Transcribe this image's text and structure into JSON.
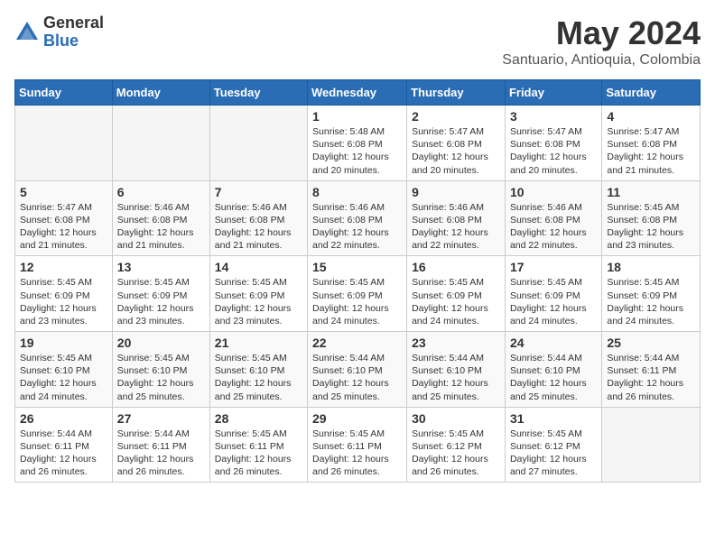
{
  "logo": {
    "general": "General",
    "blue": "Blue"
  },
  "title": "May 2024",
  "location": "Santuario, Antioquia, Colombia",
  "weekdays": [
    "Sunday",
    "Monday",
    "Tuesday",
    "Wednesday",
    "Thursday",
    "Friday",
    "Saturday"
  ],
  "weeks": [
    [
      {
        "day": "",
        "info": ""
      },
      {
        "day": "",
        "info": ""
      },
      {
        "day": "",
        "info": ""
      },
      {
        "day": "1",
        "info": "Sunrise: 5:48 AM\nSunset: 6:08 PM\nDaylight: 12 hours\nand 20 minutes."
      },
      {
        "day": "2",
        "info": "Sunrise: 5:47 AM\nSunset: 6:08 PM\nDaylight: 12 hours\nand 20 minutes."
      },
      {
        "day": "3",
        "info": "Sunrise: 5:47 AM\nSunset: 6:08 PM\nDaylight: 12 hours\nand 20 minutes."
      },
      {
        "day": "4",
        "info": "Sunrise: 5:47 AM\nSunset: 6:08 PM\nDaylight: 12 hours\nand 21 minutes."
      }
    ],
    [
      {
        "day": "5",
        "info": "Sunrise: 5:47 AM\nSunset: 6:08 PM\nDaylight: 12 hours\nand 21 minutes."
      },
      {
        "day": "6",
        "info": "Sunrise: 5:46 AM\nSunset: 6:08 PM\nDaylight: 12 hours\nand 21 minutes."
      },
      {
        "day": "7",
        "info": "Sunrise: 5:46 AM\nSunset: 6:08 PM\nDaylight: 12 hours\nand 21 minutes."
      },
      {
        "day": "8",
        "info": "Sunrise: 5:46 AM\nSunset: 6:08 PM\nDaylight: 12 hours\nand 22 minutes."
      },
      {
        "day": "9",
        "info": "Sunrise: 5:46 AM\nSunset: 6:08 PM\nDaylight: 12 hours\nand 22 minutes."
      },
      {
        "day": "10",
        "info": "Sunrise: 5:46 AM\nSunset: 6:08 PM\nDaylight: 12 hours\nand 22 minutes."
      },
      {
        "day": "11",
        "info": "Sunrise: 5:45 AM\nSunset: 6:08 PM\nDaylight: 12 hours\nand 23 minutes."
      }
    ],
    [
      {
        "day": "12",
        "info": "Sunrise: 5:45 AM\nSunset: 6:09 PM\nDaylight: 12 hours\nand 23 minutes."
      },
      {
        "day": "13",
        "info": "Sunrise: 5:45 AM\nSunset: 6:09 PM\nDaylight: 12 hours\nand 23 minutes."
      },
      {
        "day": "14",
        "info": "Sunrise: 5:45 AM\nSunset: 6:09 PM\nDaylight: 12 hours\nand 23 minutes."
      },
      {
        "day": "15",
        "info": "Sunrise: 5:45 AM\nSunset: 6:09 PM\nDaylight: 12 hours\nand 24 minutes."
      },
      {
        "day": "16",
        "info": "Sunrise: 5:45 AM\nSunset: 6:09 PM\nDaylight: 12 hours\nand 24 minutes."
      },
      {
        "day": "17",
        "info": "Sunrise: 5:45 AM\nSunset: 6:09 PM\nDaylight: 12 hours\nand 24 minutes."
      },
      {
        "day": "18",
        "info": "Sunrise: 5:45 AM\nSunset: 6:09 PM\nDaylight: 12 hours\nand 24 minutes."
      }
    ],
    [
      {
        "day": "19",
        "info": "Sunrise: 5:45 AM\nSunset: 6:10 PM\nDaylight: 12 hours\nand 24 minutes."
      },
      {
        "day": "20",
        "info": "Sunrise: 5:45 AM\nSunset: 6:10 PM\nDaylight: 12 hours\nand 25 minutes."
      },
      {
        "day": "21",
        "info": "Sunrise: 5:45 AM\nSunset: 6:10 PM\nDaylight: 12 hours\nand 25 minutes."
      },
      {
        "day": "22",
        "info": "Sunrise: 5:44 AM\nSunset: 6:10 PM\nDaylight: 12 hours\nand 25 minutes."
      },
      {
        "day": "23",
        "info": "Sunrise: 5:44 AM\nSunset: 6:10 PM\nDaylight: 12 hours\nand 25 minutes."
      },
      {
        "day": "24",
        "info": "Sunrise: 5:44 AM\nSunset: 6:10 PM\nDaylight: 12 hours\nand 25 minutes."
      },
      {
        "day": "25",
        "info": "Sunrise: 5:44 AM\nSunset: 6:11 PM\nDaylight: 12 hours\nand 26 minutes."
      }
    ],
    [
      {
        "day": "26",
        "info": "Sunrise: 5:44 AM\nSunset: 6:11 PM\nDaylight: 12 hours\nand 26 minutes."
      },
      {
        "day": "27",
        "info": "Sunrise: 5:44 AM\nSunset: 6:11 PM\nDaylight: 12 hours\nand 26 minutes."
      },
      {
        "day": "28",
        "info": "Sunrise: 5:45 AM\nSunset: 6:11 PM\nDaylight: 12 hours\nand 26 minutes."
      },
      {
        "day": "29",
        "info": "Sunrise: 5:45 AM\nSunset: 6:11 PM\nDaylight: 12 hours\nand 26 minutes."
      },
      {
        "day": "30",
        "info": "Sunrise: 5:45 AM\nSunset: 6:12 PM\nDaylight: 12 hours\nand 26 minutes."
      },
      {
        "day": "31",
        "info": "Sunrise: 5:45 AM\nSunset: 6:12 PM\nDaylight: 12 hours\nand 27 minutes."
      },
      {
        "day": "",
        "info": ""
      }
    ]
  ]
}
